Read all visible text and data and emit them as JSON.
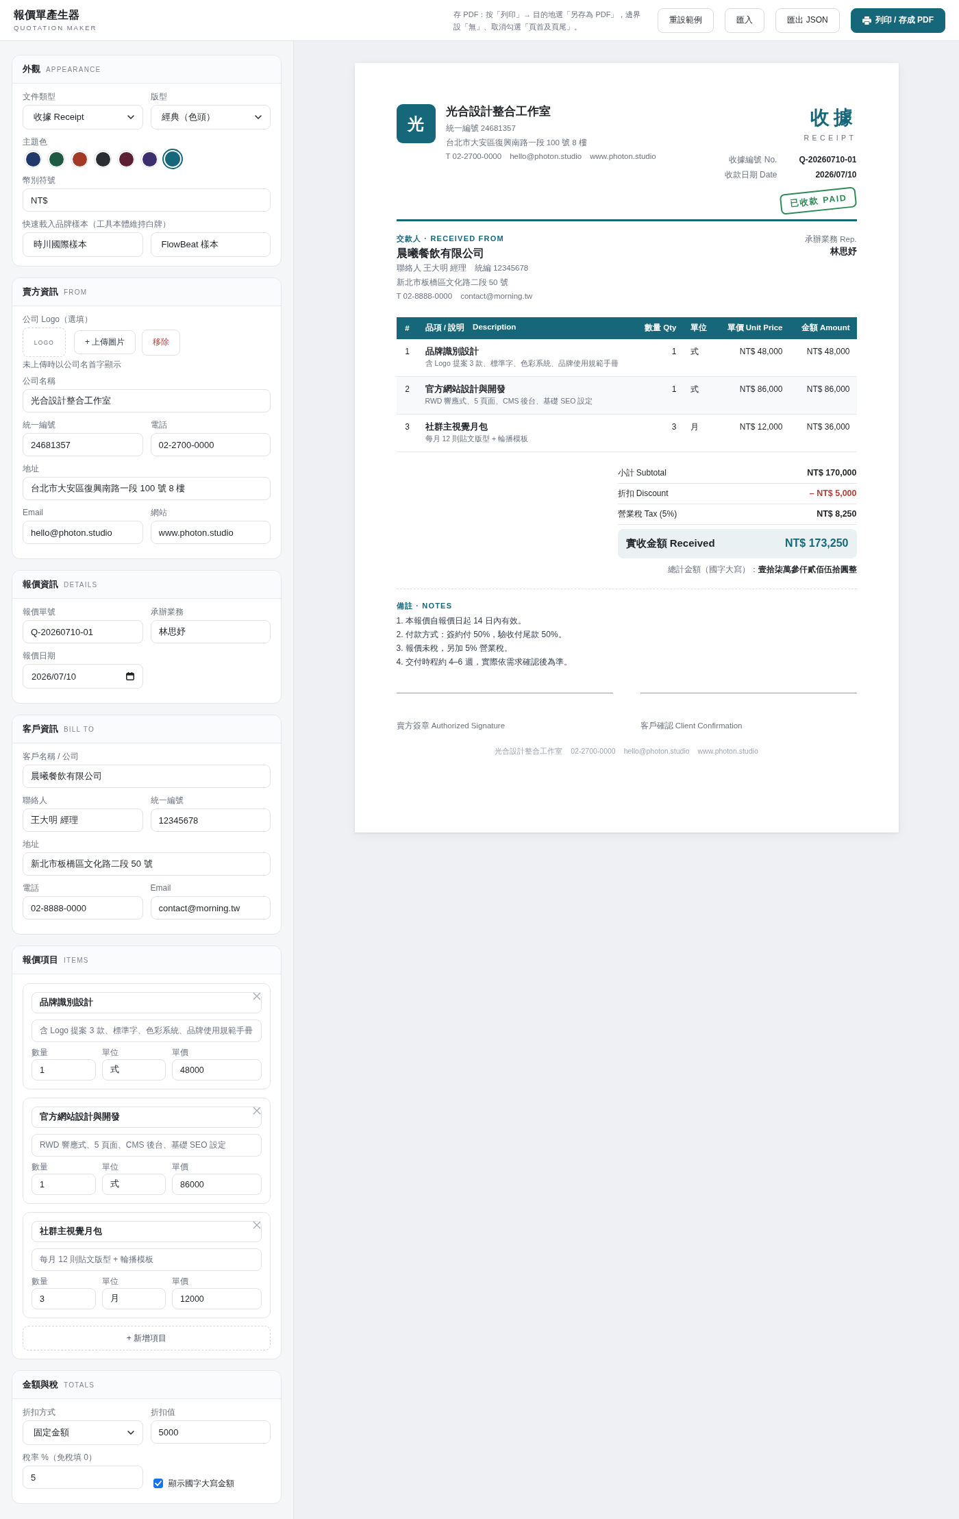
{
  "topbar": {
    "title": "報價單產生器",
    "subtitle": "QUOTATION MAKER",
    "hint": "存 PDF：按「列印」→ 目的地選「另存為 PDF」，邊界設「無」、取消勾選「頁首及頁尾」。",
    "buttons": [
      {
        "label": "重設範例",
        "kind": "secondary"
      },
      {
        "label": "匯入",
        "kind": "secondary"
      },
      {
        "label": "匯出 JSON",
        "kind": "secondary"
      },
      {
        "label": "列印 / 存成 PDF",
        "kind": "primary"
      }
    ]
  },
  "sidebar": [
    {
      "title": "外觀",
      "subtitle": "APPEARANCE",
      "rows": [
        {
          "kind": "fields",
          "fields": [
            {
              "kind": "select",
              "label": "文件類型",
              "value": "收據 Receipt"
            },
            {
              "kind": "select",
              "label": "版型",
              "value": "經典（色頭）"
            }
          ]
        },
        {
          "kind": "swatches",
          "label": "主題色",
          "swatches": [
            {
              "color": "#1f3a68",
              "selected": false
            },
            {
              "color": "#1e5a43",
              "selected": false
            },
            {
              "color": "#a33a24",
              "selected": false
            },
            {
              "color": "#2a2d31",
              "selected": false
            },
            {
              "color": "#5c1f33",
              "selected": false
            },
            {
              "color": "#3d2f6e",
              "selected": false
            },
            {
              "color": "#17677b",
              "selected": true
            }
          ]
        },
        {
          "kind": "fields",
          "fields": [
            {
              "kind": "text",
              "label": "幣別符號",
              "value": "NT$"
            }
          ]
        },
        {
          "kind": "buttons",
          "label": "快速載入品牌樣本（工具本體維持白牌）",
          "buttons": [
            "時川國際樣本",
            "FlowBeat 樣本"
          ]
        }
      ]
    },
    {
      "title": "賣方資訊",
      "subtitle": "FROM",
      "rows": [
        {
          "kind": "logo",
          "label": "公司 Logo（選填）",
          "placeholder": "LOGO",
          "upload": "+ 上傳圖片",
          "remove": "移除",
          "hint": "未上傳時以公司名首字顯示"
        },
        {
          "kind": "fields",
          "fields": [
            {
              "kind": "text",
              "label": "公司名稱",
              "value": "光合設計整合工作室"
            }
          ]
        },
        {
          "kind": "fields",
          "fields": [
            {
              "kind": "text",
              "label": "統一編號",
              "value": "24681357"
            },
            {
              "kind": "text",
              "label": "電話",
              "value": "02-2700-0000"
            }
          ]
        },
        {
          "kind": "fields",
          "fields": [
            {
              "kind": "text",
              "label": "地址",
              "value": "台北市大安區復興南路一段 100 號 8 樓"
            }
          ]
        },
        {
          "kind": "fields",
          "fields": [
            {
              "kind": "text",
              "label": "Email",
              "value": "hello@photon.studio"
            },
            {
              "kind": "text",
              "label": "網站",
              "value": "www.photon.studio"
            }
          ]
        }
      ]
    },
    {
      "title": "報價資訊",
      "subtitle": "DETAILS",
      "rows": [
        {
          "kind": "fields",
          "fields": [
            {
              "kind": "text",
              "label": "報價單號",
              "value": "Q-20260710-01"
            },
            {
              "kind": "text",
              "label": "承辦業務",
              "value": "林思妤"
            }
          ]
        },
        {
          "kind": "fields",
          "fields": [
            {
              "kind": "date",
              "label": "報價日期",
              "value": "2026/07/10"
            }
          ]
        }
      ]
    },
    {
      "title": "客戶資訊",
      "subtitle": "BILL TO",
      "rows": [
        {
          "kind": "fields",
          "fields": [
            {
              "kind": "text",
              "label": "客戶名稱 / 公司",
              "value": "晨曦餐飲有限公司"
            }
          ]
        },
        {
          "kind": "fields",
          "fields": [
            {
              "kind": "text",
              "label": "聯絡人",
              "value": "王大明 經理"
            },
            {
              "kind": "text",
              "label": "統一編號",
              "value": "12345678"
            }
          ]
        },
        {
          "kind": "fields",
          "fields": [
            {
              "kind": "text",
              "label": "地址",
              "value": "新北市板橋區文化路二段 50 號"
            }
          ]
        },
        {
          "kind": "fields",
          "fields": [
            {
              "kind": "text",
              "label": "電話",
              "value": "02-8888-0000"
            },
            {
              "kind": "text",
              "label": "Email",
              "value": "contact@morning.tw"
            }
          ]
        }
      ]
    },
    {
      "title": "報價項目",
      "subtitle": "ITEMS",
      "rows": [
        {
          "kind": "items",
          "items": [
            {
              "name": "品牌識別設計",
              "description": "含 Logo 提案 3 款、標準字、色彩系統、品牌使用規範手冊",
              "fields": [
                {
                  "label": "數量",
                  "value": "1"
                },
                {
                  "label": "單位",
                  "value": "式"
                },
                {
                  "label": "單價",
                  "value": "48000"
                }
              ]
            },
            {
              "name": "官方網站設計與開發",
              "description": "RWD 響應式、5 頁面、CMS 後台、基礎 SEO 設定",
              "fields": [
                {
                  "label": "數量",
                  "value": "1"
                },
                {
                  "label": "單位",
                  "value": "式"
                },
                {
                  "label": "單價",
                  "value": "86000"
                }
              ]
            },
            {
              "name": "社群主視覺月包",
              "description": "每月 12 則貼文版型 + 輪播模板",
              "fields": [
                {
                  "label": "數量",
                  "value": "3"
                },
                {
                  "label": "單位",
                  "value": "月"
                },
                {
                  "label": "單價",
                  "value": "12000"
                }
              ]
            }
          ],
          "add": "+ 新增項目"
        }
      ]
    },
    {
      "title": "金額與稅",
      "subtitle": "TOTALS",
      "rows": [
        {
          "kind": "fields",
          "fields": [
            {
              "kind": "select",
              "label": "折扣方式",
              "value": "固定金額"
            },
            {
              "kind": "text",
              "label": "折扣值",
              "value": "5000"
            }
          ]
        },
        {
          "kind": "fields",
          "fields": [
            {
              "kind": "text",
              "label": "稅率 %（免稅填 0）",
              "value": "5"
            },
            {
              "kind": "checkbox",
              "label": "顯示國字大寫金額",
              "checked": true
            }
          ]
        }
      ]
    }
  ],
  "document": {
    "logo_mark": "光",
    "company": {
      "name": "光合設計整合工作室",
      "lines": [
        "統一編號 24681357",
        "台北市大安區復興南路一段 100 號 8 樓"
      ],
      "contacts": [
        "T 02-2700-0000",
        "hello@photon.studio",
        "www.photon.studio"
      ]
    },
    "title": "收據",
    "subtitle": "RECEIPT",
    "meta": [
      {
        "label": "收據編號 No.",
        "value": "Q-20260710-01"
      },
      {
        "label": "收款日期 Date",
        "value": "2026/07/10"
      }
    ],
    "stamp": "已收款 PAID",
    "party": {
      "heading": "交款人 · RECEIVED FROM",
      "name": "晨曦餐飲有限公司",
      "lines": [
        [
          "聯絡人 王大明 經理",
          "統編 12345678"
        ],
        [
          "新北市板橋區文化路二段 50 號"
        ],
        [
          "T 02-8888-0000",
          "contact@morning.tw"
        ]
      ]
    },
    "rep": {
      "label": "承辦業務 Rep.",
      "value": "林思妤"
    },
    "table": {
      "columns": [
        {
          "kind": "index",
          "label": "#"
        },
        {
          "kind": "item",
          "label": "品項 / 說明",
          "sub": "Description"
        },
        {
          "kind": "number",
          "label": "數量 Qty"
        },
        {
          "kind": "text",
          "label": "單位"
        },
        {
          "kind": "number",
          "label": "單價 Unit Price"
        },
        {
          "kind": "number",
          "label": "金額 Amount"
        }
      ],
      "rows": [
        {
          "no": "1",
          "name": "品牌識別設計",
          "description": "含 Logo 提案 3 款、標準字、色彩系統、品牌使用規範手冊",
          "qty": "1",
          "unit": "式",
          "unit_price": "NT$ 48,000",
          "amount": "NT$ 48,000"
        },
        {
          "no": "2",
          "name": "官方網站設計與開發",
          "description": "RWD 響應式、5 頁面、CMS 後台、基礎 SEO 設定",
          "qty": "1",
          "unit": "式",
          "unit_price": "NT$ 86,000",
          "amount": "NT$ 86,000"
        },
        {
          "no": "3",
          "name": "社群主視覺月包",
          "description": "每月 12 則貼文版型 + 輪播模板",
          "qty": "3",
          "unit": "月",
          "unit_price": "NT$ 12,000",
          "amount": "NT$ 36,000"
        }
      ]
    },
    "totals": [
      {
        "kind": "normal",
        "label": "小計 Subtotal",
        "value": "NT$ 170,000"
      },
      {
        "kind": "deduction",
        "label": "折扣 Discount",
        "value": "– NT$ 5,000"
      },
      {
        "kind": "normal",
        "label": "營業稅 Tax (5%)",
        "value": "NT$ 8,250"
      }
    ],
    "grand_total": {
      "label": "實收金額 Received",
      "value": "NT$ 173,250"
    },
    "amount_in_words": "總計金額（國字大寫）：**壹拾柒萬參仟貳佰伍拾圓整**",
    "notes": {
      "heading": "備註 · NOTES",
      "lines": [
        "1. 本報價自報價日起 14 日內有效。",
        "2. 付款方式：簽約付 50%，驗收付尾款 50%。",
        "3. 報價未稅，另加 5% 營業稅。",
        "4. 交付時程約 4–6 週，實際依需求確認後為準。"
      ]
    },
    "signatures": [
      "賣方簽章 Authorized Signature",
      "客戶確認 Client Confirmation"
    ],
    "footer": [
      "光合設計整合工作室",
      "02-2700-0000",
      "hello@photon.studio",
      "www.photon.studio"
    ]
  }
}
